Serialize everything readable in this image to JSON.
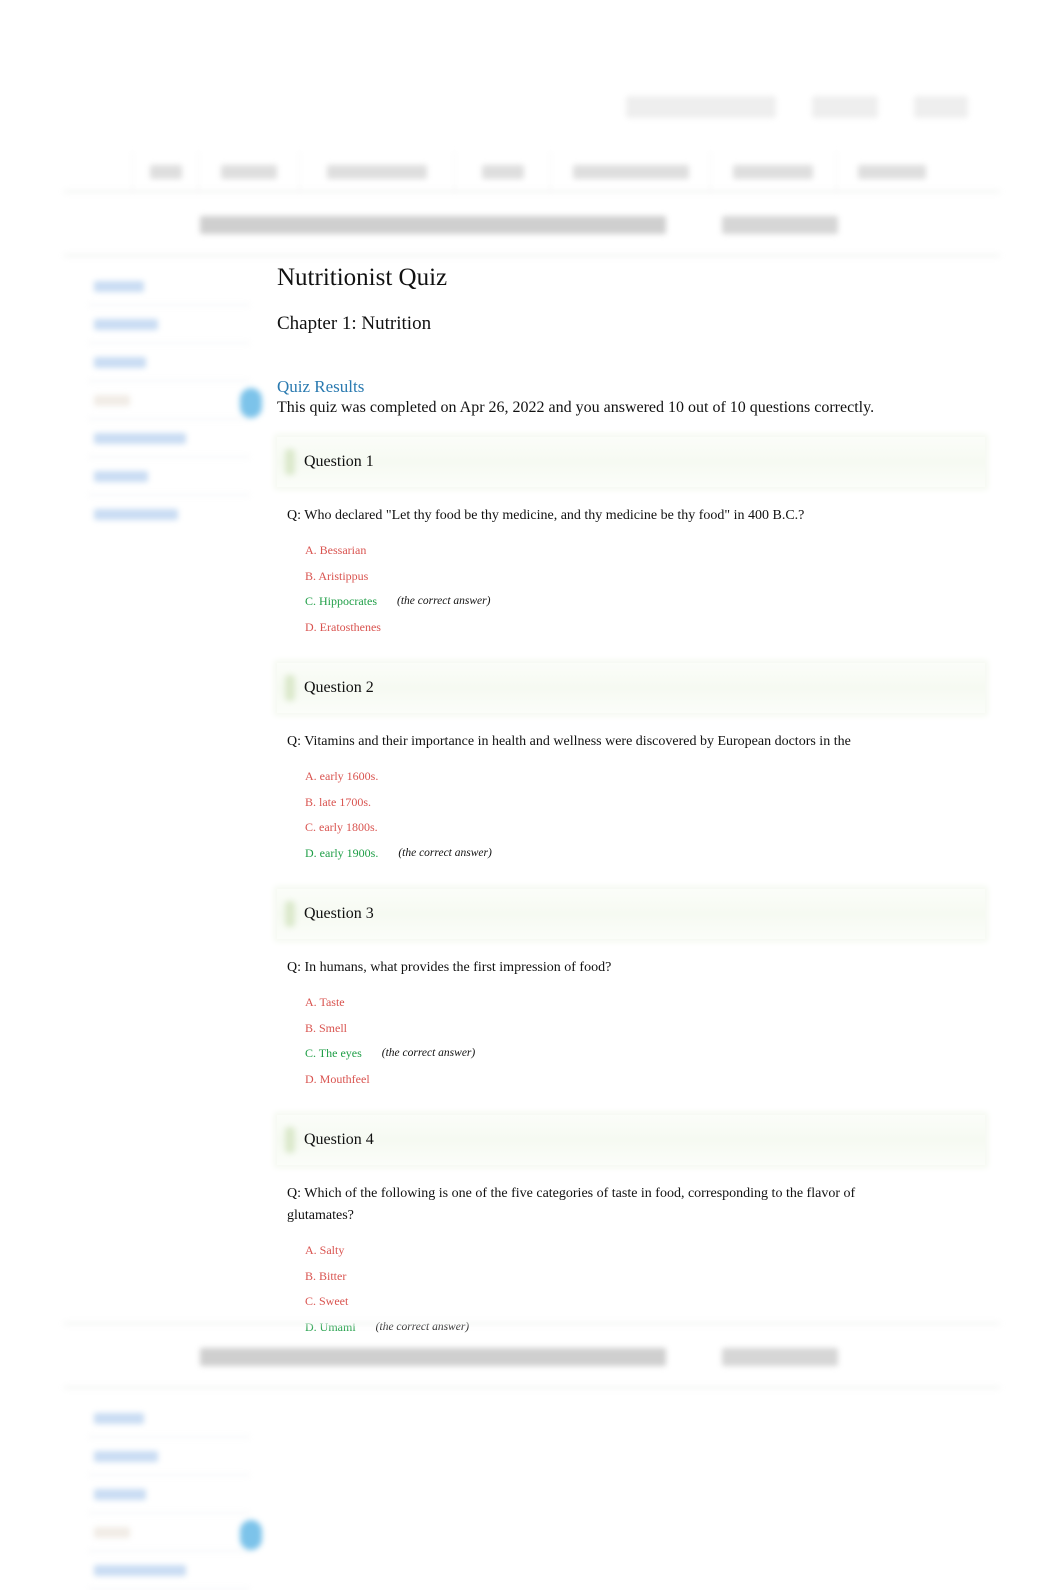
{
  "header": {
    "blurred_note": "site header, navigation and banner are blurred/unreadable",
    "util_items": 3,
    "nav_items": 8
  },
  "sidebar": {
    "items": [
      {
        "label": "",
        "style": "link"
      },
      {
        "label": "",
        "style": "link"
      },
      {
        "label": "",
        "style": "link"
      },
      {
        "label": "",
        "style": "muted"
      },
      {
        "label": "",
        "style": "link"
      },
      {
        "label": "",
        "style": "link"
      },
      {
        "label": "",
        "style": "link"
      }
    ]
  },
  "main": {
    "title": "Nutritionist Quiz",
    "chapter": "Chapter 1: Nutrition",
    "results_link": "Quiz Results",
    "summary": "This quiz was completed on Apr 26, 2022 and you answered 10 out of 10 questions correctly.",
    "correct_note": "(the correct answer)",
    "colors": {
      "wrong": "#d9534f",
      "correct": "#1e9e46",
      "link": "#2a7ab0"
    },
    "questions": [
      {
        "label": "Question 1",
        "text": "Q:  Who declared \"Let thy food be thy medicine, and thy medicine be thy food\" in 400 B.C.?",
        "answers": [
          {
            "text": "A. Bessarian",
            "correct": false
          },
          {
            "text": "B. Aristippus",
            "correct": false
          },
          {
            "text": "C. Hippocrates",
            "correct": true
          },
          {
            "text": "D. Eratosthenes",
            "correct": false
          }
        ]
      },
      {
        "label": "Question 2",
        "text": "Q:  Vitamins and their importance in health and wellness were discovered by European doctors in the",
        "answers": [
          {
            "text": "A. early 1600s.",
            "correct": false
          },
          {
            "text": "B. late 1700s.",
            "correct": false
          },
          {
            "text": "C. early 1800s.",
            "correct": false
          },
          {
            "text": "D. early 1900s.",
            "correct": true
          }
        ]
      },
      {
        "label": "Question 3",
        "text": "Q:  In humans, what provides the first impression of food?",
        "answers": [
          {
            "text": "A. Taste",
            "correct": false
          },
          {
            "text": "B. Smell",
            "correct": false
          },
          {
            "text": "C. The eyes",
            "correct": true
          },
          {
            "text": "D. Mouthfeel",
            "correct": false
          }
        ]
      },
      {
        "label": "Question 4",
        "text": "Q:  Which of the following is one of the five categories of taste in food, corresponding to the flavor of glutamates?",
        "answers": [
          {
            "text": "A. Salty",
            "correct": false
          },
          {
            "text": "B. Bitter",
            "correct": false
          },
          {
            "text": "C. Sweet",
            "correct": false
          },
          {
            "text": "D. Umami",
            "correct": true
          }
        ]
      }
    ]
  }
}
